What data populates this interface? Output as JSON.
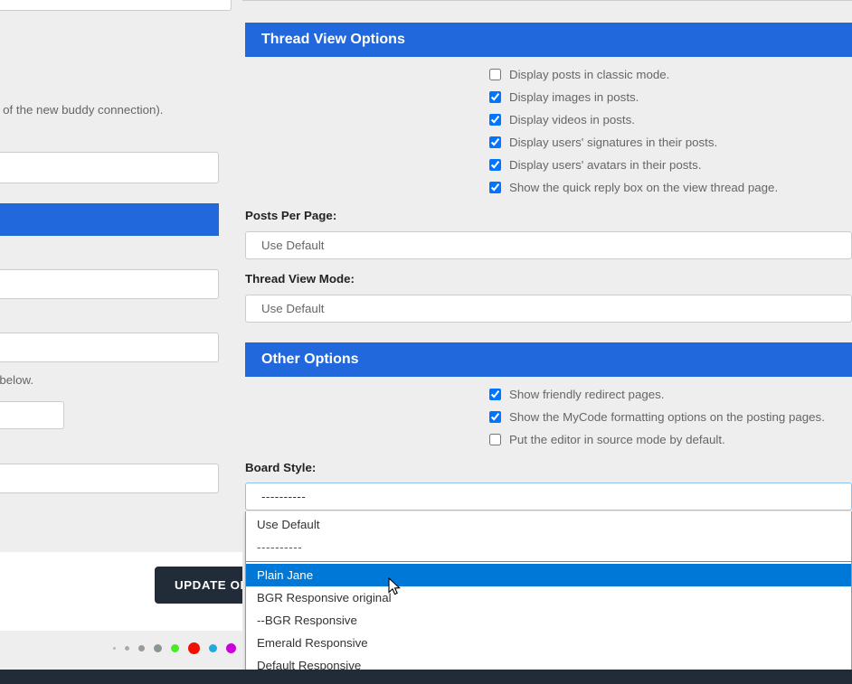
{
  "left_panel": {
    "fragment_text": "g of the new buddy connection).",
    "fragment_text_2": "t below.",
    "update_button_label": "UPDATE OP",
    "dots": [
      {
        "color": "#b8b8b8",
        "size": 3
      },
      {
        "color": "#aaaaaa",
        "size": 5
      },
      {
        "color": "#9a9a9a",
        "size": 7
      },
      {
        "color": "#8c9499",
        "size": 9
      },
      {
        "color": "#44ee22",
        "size": 9
      },
      {
        "color": "#ee1100",
        "size": 13
      },
      {
        "color": "#22aadd",
        "size": 9
      },
      {
        "color": "#cc00dd",
        "size": 11
      }
    ]
  },
  "thread_view_options": {
    "title": "Thread View Options",
    "checkboxes": [
      {
        "label": "Display posts in classic mode.",
        "checked": false
      },
      {
        "label": "Display images in posts.",
        "checked": true
      },
      {
        "label": "Display videos in posts.",
        "checked": true
      },
      {
        "label": "Display users' signatures in their posts.",
        "checked": true
      },
      {
        "label": "Display users' avatars in their posts.",
        "checked": true
      },
      {
        "label": "Show the quick reply box on the view thread page.",
        "checked": true
      }
    ],
    "posts_per_page_label": "Posts Per Page:",
    "posts_per_page_value": "Use Default",
    "thread_view_mode_label": "Thread View Mode:",
    "thread_view_mode_value": "Use Default"
  },
  "other_options": {
    "title": "Other Options",
    "checkboxes": [
      {
        "label": "Show friendly redirect pages.",
        "checked": true
      },
      {
        "label": "Show the MyCode formatting options on the posting pages.",
        "checked": true
      },
      {
        "label": "Put the editor in source mode by default.",
        "checked": false
      }
    ],
    "board_style_label": "Board Style:",
    "board_style_value": "----------"
  },
  "board_style_dropdown": {
    "options": [
      {
        "label": "Use Default",
        "selected": false,
        "separator": false
      },
      {
        "label": "----------",
        "selected": false,
        "separator": true
      },
      {
        "label": "Plain Jane",
        "selected": true,
        "separator": false
      },
      {
        "label": "BGR Responsive original",
        "selected": false,
        "separator": false
      },
      {
        "label": "--BGR Responsive",
        "selected": false,
        "separator": false
      },
      {
        "label": "Emerald Responsive",
        "selected": false,
        "separator": false
      },
      {
        "label": "Default Responsive",
        "selected": false,
        "separator": false
      }
    ]
  },
  "colors": {
    "header_blue": "#2268dd",
    "highlight_blue": "#0078d7",
    "footer_dark": "#222b38",
    "page_bg": "#eeeeee"
  }
}
